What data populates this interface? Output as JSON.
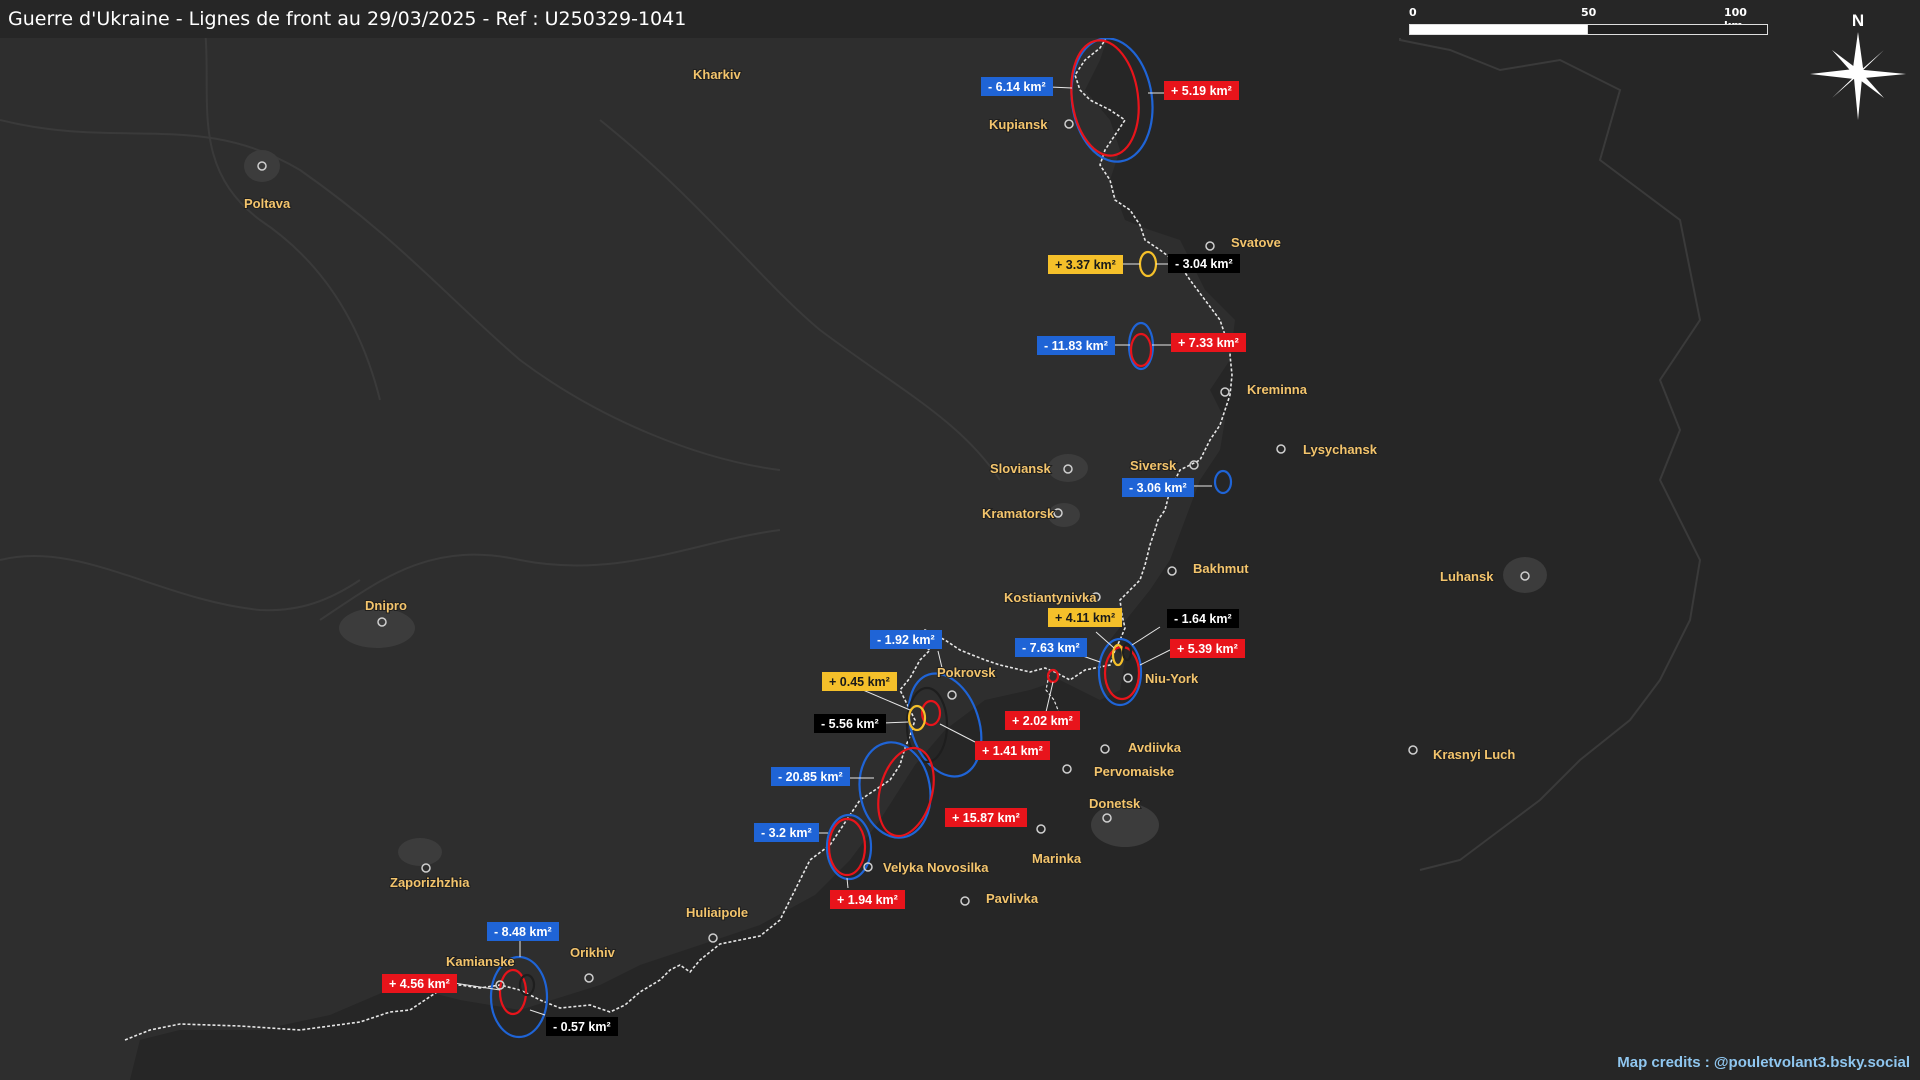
{
  "title": "Guerre d'Ukraine - Lignes de front au 29/03/2025 - Ref : U250329-1041",
  "scale_bar": {
    "labels": [
      "0",
      "50",
      "100 km"
    ]
  },
  "compass": {
    "label": "N",
    "icon": "north-arrow-compass-icon"
  },
  "credits": "Map credits : @pouletvolant3.bsky.social",
  "colors": {
    "background": "#2e2e2e",
    "occupied_region": "#262626",
    "city_label": "#f3c46c",
    "gain_red": "#e8141b",
    "loss_blue": "#1f64d6",
    "yellow": "#f5c02a",
    "black_badge": "#000000",
    "front_line": "#e6e6e6"
  },
  "cities": [
    {
      "id": "kharkiv",
      "name": "Kharkiv"
    },
    {
      "id": "poltava",
      "name": "Poltava"
    },
    {
      "id": "kupiansk",
      "name": "Kupiansk"
    },
    {
      "id": "svatove",
      "name": "Svatove"
    },
    {
      "id": "kreminna",
      "name": "Kreminna"
    },
    {
      "id": "lysychansk",
      "name": "Lysychansk"
    },
    {
      "id": "sloviansk",
      "name": "Sloviansk"
    },
    {
      "id": "siversk",
      "name": "Siversk"
    },
    {
      "id": "kramatorsk",
      "name": "Kramatorsk"
    },
    {
      "id": "bakhmut",
      "name": "Bakhmut"
    },
    {
      "id": "luhansk",
      "name": "Luhansk"
    },
    {
      "id": "kostiantynivka",
      "name": "Kostiantynivka"
    },
    {
      "id": "dnipro",
      "name": "Dnipro"
    },
    {
      "id": "pokrovsk",
      "name": "Pokrovsk"
    },
    {
      "id": "niu-york",
      "name": "Niu-York"
    },
    {
      "id": "avdiivka",
      "name": "Avdiivka"
    },
    {
      "id": "pervomaiske",
      "name": "Pervomaiske"
    },
    {
      "id": "krasnyi-luch",
      "name": "Krasnyi Luch"
    },
    {
      "id": "donetsk",
      "name": "Donetsk"
    },
    {
      "id": "marinka",
      "name": "Marinka"
    },
    {
      "id": "zaporizhzhia",
      "name": "Zaporizhzhia"
    },
    {
      "id": "velyka-novosilka",
      "name": "Velyka Novosilka"
    },
    {
      "id": "pavlivka",
      "name": "Pavlivka"
    },
    {
      "id": "huliaipole",
      "name": "Huliaipole"
    },
    {
      "id": "orikhiv",
      "name": "Orikhiv"
    },
    {
      "id": "kamianske",
      "name": "Kamianske"
    }
  ],
  "area_changes": [
    {
      "id": "kupiansk-loss",
      "text": "- 6.14 km²",
      "kind": "loss"
    },
    {
      "id": "kupiansk-gain",
      "text": "+ 5.19 km²",
      "kind": "gain"
    },
    {
      "id": "svatove-yellow",
      "text": "+ 3.37 km²",
      "kind": "yellow"
    },
    {
      "id": "svatove-black",
      "text": "- 3.04 km²",
      "kind": "black"
    },
    {
      "id": "kreminna-loss",
      "text": "- 11.83 km²",
      "kind": "loss"
    },
    {
      "id": "kreminna-gain",
      "text": "+ 7.33 km²",
      "kind": "gain"
    },
    {
      "id": "siversk-loss",
      "text": "- 3.06 km²",
      "kind": "loss"
    },
    {
      "id": "kostiantynivka-yellow",
      "text": "+ 4.11 km²",
      "kind": "yellow"
    },
    {
      "id": "kostiantynivka-black",
      "text": "- 1.64 km²",
      "kind": "black"
    },
    {
      "id": "kostiantynivka-loss",
      "text": "- 7.63 km²",
      "kind": "loss"
    },
    {
      "id": "kostiantynivka-gain",
      "text": "+ 5.39 km²",
      "kind": "gain"
    },
    {
      "id": "pokrovsk-loss",
      "text": "- 1.92 km²",
      "kind": "loss"
    },
    {
      "id": "pokrovsk-yellow",
      "text": "+ 0.45 km²",
      "kind": "yellow"
    },
    {
      "id": "pokrovsk-gain-east",
      "text": "+ 2.02 km²",
      "kind": "gain"
    },
    {
      "id": "pokrovsk-black",
      "text": "- 5.56 km²",
      "kind": "black"
    },
    {
      "id": "pokrovsk-gain",
      "text": "+ 1.41 km²",
      "kind": "gain"
    },
    {
      "id": "kurakhove-loss",
      "text": "- 20.85 km²",
      "kind": "loss"
    },
    {
      "id": "kurakhove-gain",
      "text": "+ 15.87 km²",
      "kind": "gain"
    },
    {
      "id": "velyka-loss",
      "text": "- 3.2 km²",
      "kind": "loss"
    },
    {
      "id": "velyka-gain",
      "text": "+ 1.94 km²",
      "kind": "gain"
    },
    {
      "id": "kamianske-loss",
      "text": "- 8.48 km²",
      "kind": "loss"
    },
    {
      "id": "kamianske-gain",
      "text": "+ 4.56 km²",
      "kind": "gain"
    },
    {
      "id": "kamianske-black",
      "text": "- 0.57 km²",
      "kind": "black"
    }
  ]
}
